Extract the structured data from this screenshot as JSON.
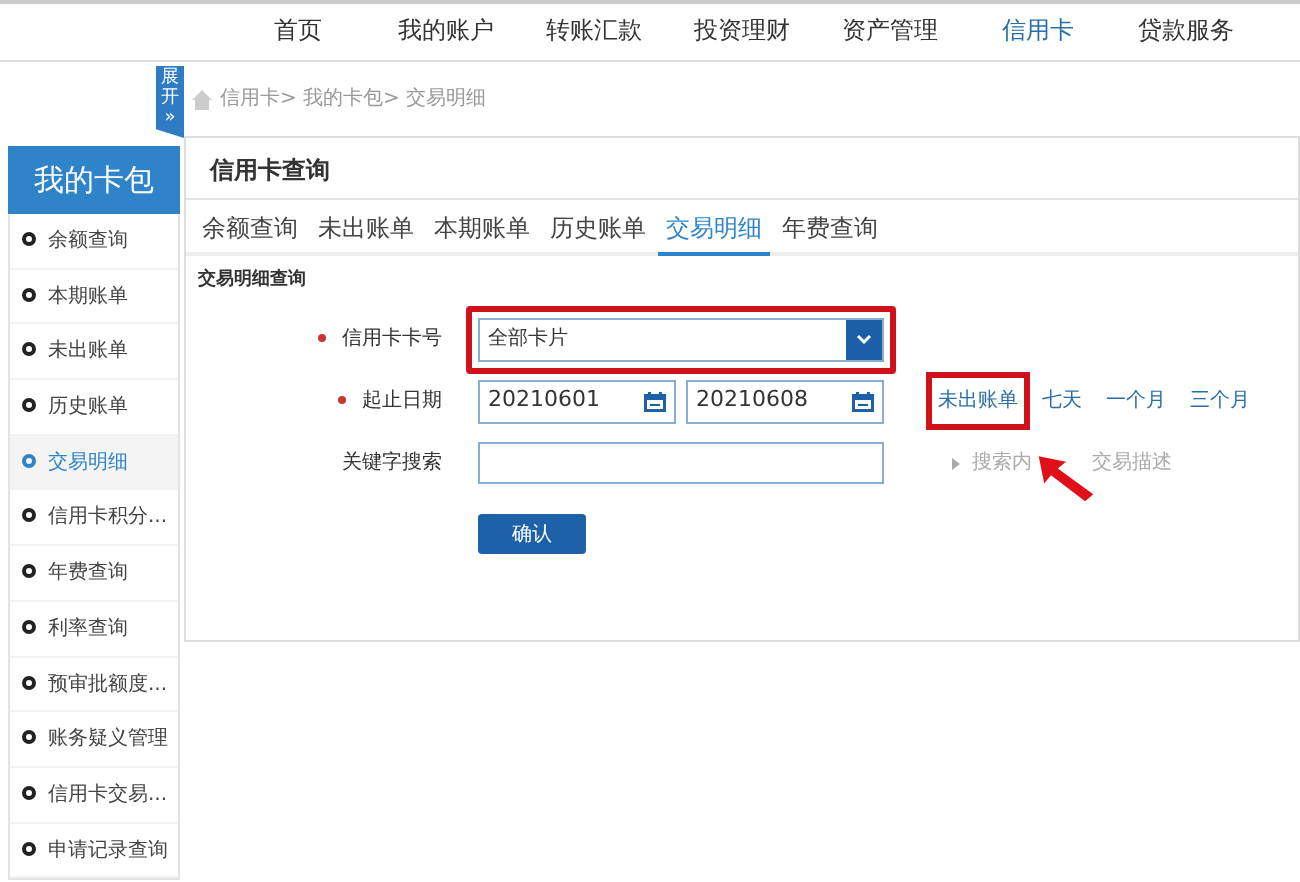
{
  "top_nav": [
    {
      "label": "首页",
      "selected": false
    },
    {
      "label": "我的账户",
      "selected": false
    },
    {
      "label": "转账汇款",
      "selected": false
    },
    {
      "label": "投资理财",
      "selected": false
    },
    {
      "label": "资产管理",
      "selected": false
    },
    {
      "label": "信用卡",
      "selected": true
    },
    {
      "label": "贷款服务",
      "selected": false
    }
  ],
  "expand_tab": {
    "label": "展开",
    "glyph": "»"
  },
  "breadcrumb": "信用卡> 我的卡包> 交易明细",
  "sidebar": {
    "title": "我的卡包",
    "items": [
      {
        "label": "余额查询",
        "selected": false
      },
      {
        "label": "本期账单",
        "selected": false
      },
      {
        "label": "未出账单",
        "selected": false
      },
      {
        "label": "历史账单",
        "selected": false
      },
      {
        "label": "交易明细",
        "selected": true
      },
      {
        "label": "信用卡积分...",
        "selected": false
      },
      {
        "label": "年费查询",
        "selected": false
      },
      {
        "label": "利率查询",
        "selected": false
      },
      {
        "label": "预审批额度...",
        "selected": false
      },
      {
        "label": "账务疑义管理",
        "selected": false
      },
      {
        "label": "信用卡交易...",
        "selected": false
      },
      {
        "label": "申请记录查询",
        "selected": false
      }
    ]
  },
  "panel": {
    "title": "信用卡查询",
    "tabs": [
      {
        "label": "余额查询",
        "selected": false
      },
      {
        "label": "未出账单",
        "selected": false
      },
      {
        "label": "本期账单",
        "selected": false
      },
      {
        "label": "历史账单",
        "selected": false
      },
      {
        "label": "交易明细",
        "selected": true
      },
      {
        "label": "年费查询",
        "selected": false
      }
    ],
    "section_title": "交易明细查询",
    "card_field": {
      "label": "信用卡卡号",
      "required": true,
      "value": "全部卡片",
      "highlighted": true
    },
    "date_field": {
      "label": "起止日期",
      "required": true,
      "start": "20210601",
      "end": "20210608",
      "quick_ranges": [
        {
          "label": "未出账单",
          "highlighted": true
        },
        {
          "label": "七天",
          "highlighted": false
        },
        {
          "label": "一个月",
          "highlighted": false
        },
        {
          "label": "三个月",
          "highlighted": false
        }
      ]
    },
    "keyword_field": {
      "label": "关键字搜索",
      "hint_parts": [
        "搜索内",
        "交易描述"
      ]
    },
    "confirm_button": "确认"
  }
}
